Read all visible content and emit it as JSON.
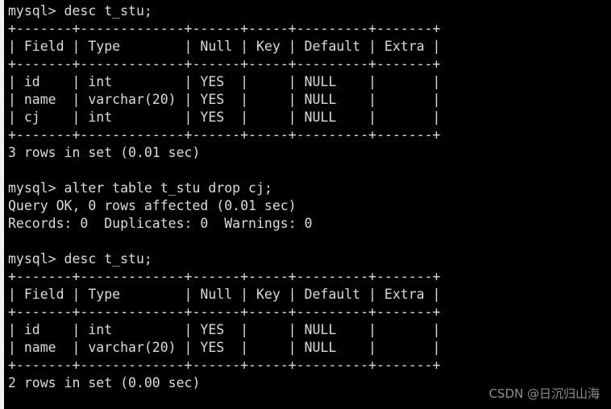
{
  "terminal": {
    "app": "mysql-client",
    "background_color": "#000000",
    "foreground_color": "#dcdcdc",
    "prompt": "mysql>",
    "lines": [
      "mysql> desc t_stu;",
      "+-------+-------------+------+-----+---------+-------+",
      "| Field | Type        | Null | Key | Default | Extra |",
      "+-------+-------------+------+-----+---------+-------+",
      "| id    | int         | YES  |     | NULL    |       |",
      "| name  | varchar(20) | YES  |     | NULL    |       |",
      "| cj    | int         | YES  |     | NULL    |       |",
      "+-------+-------------+------+-----+---------+-------+",
      "3 rows in set (0.01 sec)",
      "",
      "mysql> alter table t_stu drop cj;",
      "Query OK, 0 rows affected (0.01 sec)",
      "Records: 0  Duplicates: 0  Warnings: 0",
      "",
      "mysql> desc t_stu;",
      "+-------+-------------+------+-----+---------+-------+",
      "| Field | Type        | Null | Key | Default | Extra |",
      "+-------+-------------+------+-----+---------+-------+",
      "| id    | int         | YES  |     | NULL    |       |",
      "| name  | varchar(20) | YES  |     | NULL    |       |",
      "+-------+-------------+------+-----+---------+-------+",
      "2 rows in set (0.00 sec)"
    ],
    "commands": [
      "desc t_stu;",
      "alter table t_stu drop cj;",
      "desc t_stu;"
    ],
    "result_tables": [
      {
        "headers": [
          "Field",
          "Type",
          "Null",
          "Key",
          "Default",
          "Extra"
        ],
        "rows": [
          [
            "id",
            "int",
            "YES",
            "",
            "NULL",
            ""
          ],
          [
            "name",
            "varchar(20)",
            "YES",
            "",
            "NULL",
            ""
          ],
          [
            "cj",
            "int",
            "YES",
            "",
            "NULL",
            ""
          ]
        ],
        "footer": "3 rows in set (0.01 sec)"
      },
      {
        "headers": [
          "Field",
          "Type",
          "Null",
          "Key",
          "Default",
          "Extra"
        ],
        "rows": [
          [
            "id",
            "int",
            "YES",
            "",
            "NULL",
            ""
          ],
          [
            "name",
            "varchar(20)",
            "YES",
            "",
            "NULL",
            ""
          ]
        ],
        "footer": "2 rows in set (0.00 sec)"
      }
    ],
    "status_messages": [
      "Query OK, 0 rows affected (0.01 sec)",
      "Records: 0  Duplicates: 0  Warnings: 0"
    ]
  },
  "watermark": {
    "text": "CSDN @日沉归山海",
    "color": "#8f8f8f"
  }
}
